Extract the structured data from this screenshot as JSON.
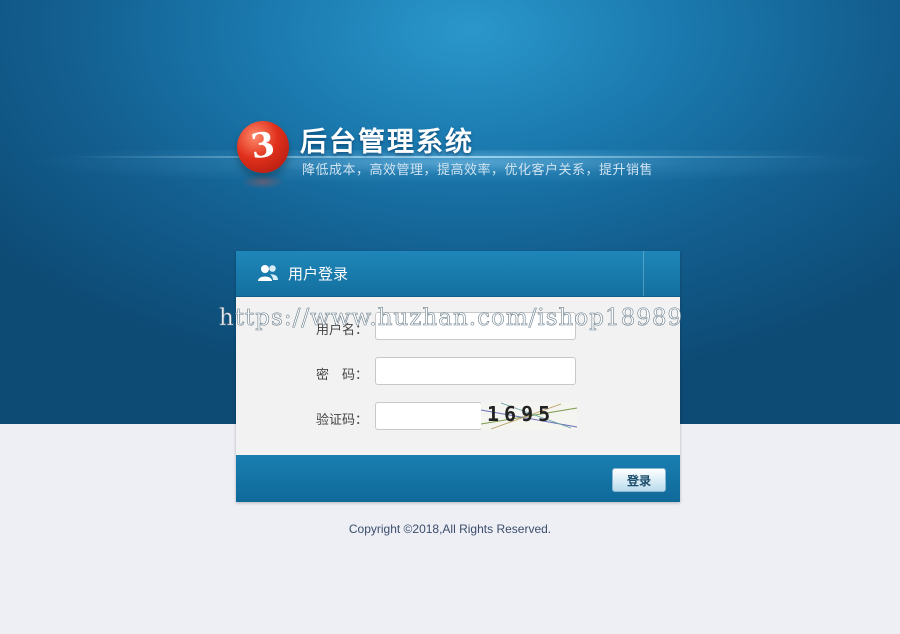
{
  "header": {
    "app_title": "后台管理系统",
    "slogan": "降低成本，高效管理，提高效率，优化客户关系，提升销售"
  },
  "login_panel": {
    "title": "用户登录",
    "username_label": "用户名：",
    "password_label": "密　码：",
    "captcha_label": "验证码：",
    "username_value": "",
    "password_value": "",
    "captcha_value": "",
    "captcha_text": "1695",
    "login_button_label": "登录"
  },
  "watermark": "https://www.huzhan.com/ishop18989",
  "footer": {
    "copyright": "Copyright ©2018,All Rights Reserved."
  },
  "colors": {
    "hero_blue": "#1a78ad",
    "panel_header": "#1f86b9",
    "page_background": "#eeeff5",
    "logo_red": "#e0301c"
  }
}
